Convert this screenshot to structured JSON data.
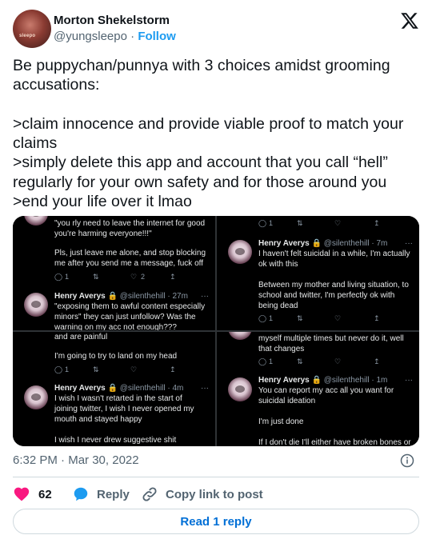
{
  "author": {
    "name": "Morton Shekelstorm",
    "handle": "@yungsleepo",
    "separator": "·",
    "follow_label": "Follow",
    "avatar_tag": "sleepo"
  },
  "tweet": {
    "lines": [
      "Be puppychan/punnya with 3 choices amidst grooming",
      "accusations:",
      "",
      ">claim innocence and provide viable proof to match your",
      "claims",
      ">simply delete this app and account that you call “hell”",
      "regularly for your own safety and for those around you",
      ">end your life over it lmao"
    ]
  },
  "media": {
    "panel1": {
      "top_lines": [
        "\"you rly need to leave the internet for good",
        "you're harming everyone!!!\""
      ],
      "body_lines": [
        "Pls, just leave me alone, and stop blocking",
        "me after you send me a message, fuck off"
      ],
      "reply_count": "1",
      "like_count": "2",
      "tweet2_name": "Henry Averys",
      "tweet2_meta": "@silenthehill · 27m",
      "tweet2_lines": [
        "\"exposing them to awful content especially",
        "minors\" they can just unfollow? Was the",
        "warning on my acc not enough???"
      ]
    },
    "panel2": {
      "top_reply_count": "1",
      "name": "Henry Averys",
      "meta": "@silenthehill · 7m",
      "lines": [
        "I haven't felt suicidal in a while, I'm actually",
        "ok with this",
        "",
        "Between my mother and living situation, to",
        "school and twitter, I'm perfectly ok with",
        "being dead"
      ],
      "reply_count": "1"
    },
    "panel3": {
      "top_lines": [
        "and are painful",
        "",
        "I'm going to try to land on my head"
      ],
      "reply_count": "1",
      "name": "Henry Averys",
      "meta": "@silenthehill · 4m",
      "lines": [
        "I wish I wasn't retarted in the start of",
        "joining twitter, I wish I never opened my",
        "mouth and stayed happy",
        "",
        "I wish I never drew suggestive shit"
      ]
    },
    "panel4": {
      "top_lines": [
        "myself multiple times but never do it, well",
        "that changes"
      ],
      "reply_count": "1",
      "name": "Henry Averys",
      "meta": "@silenthehill · 1m",
      "lines": [
        "You can report my acc all you want for",
        "suicidal ideation",
        "",
        "I'm just done",
        "",
        "If I don't die I'll either have broken bones or"
      ]
    }
  },
  "meta": {
    "time": "6:32 PM",
    "separator": "·",
    "date": "Mar 30, 2022"
  },
  "actions": {
    "like_count": "62",
    "reply_label": "Reply",
    "copy_label": "Copy link to post"
  },
  "read_reply_label": "Read 1 reply",
  "colors": {
    "accent": "#1d9bf0",
    "heart": "#f91880",
    "text": "#0f1419",
    "secondary": "#536471"
  }
}
